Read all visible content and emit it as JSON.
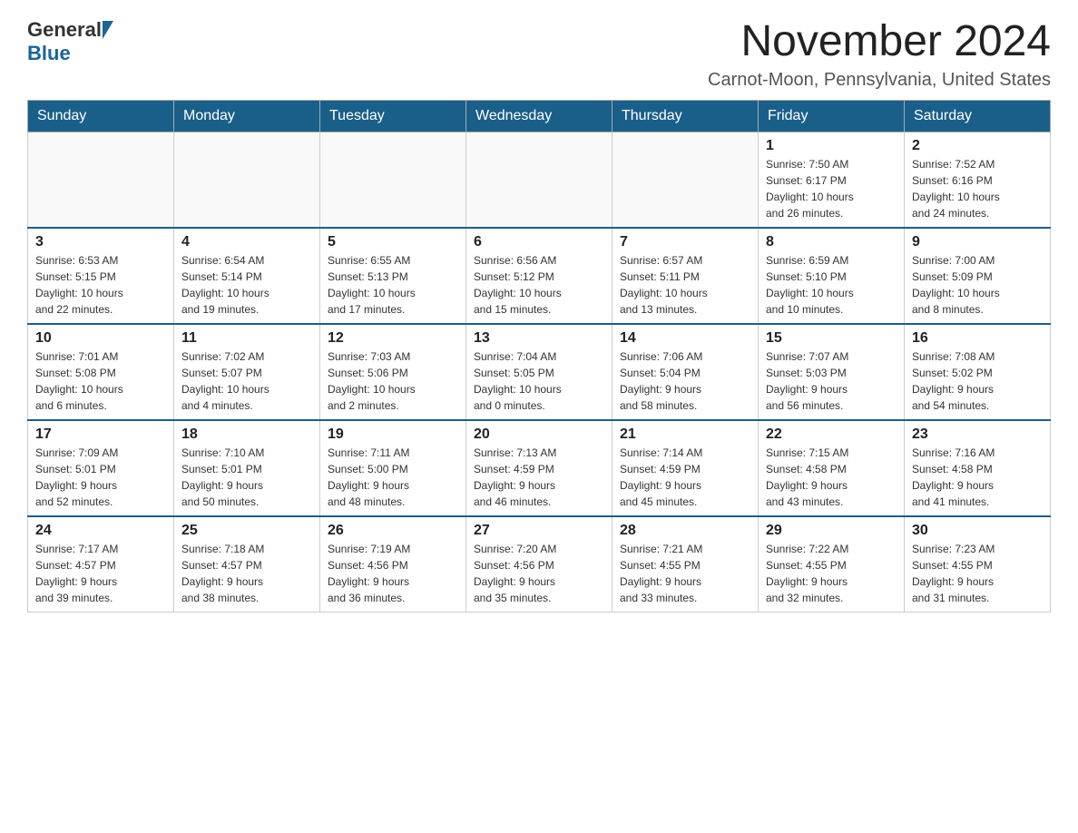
{
  "logo": {
    "general": "General",
    "blue": "Blue"
  },
  "title": "November 2024",
  "subtitle": "Carnot-Moon, Pennsylvania, United States",
  "days_of_week": [
    "Sunday",
    "Monday",
    "Tuesday",
    "Wednesday",
    "Thursday",
    "Friday",
    "Saturday"
  ],
  "weeks": [
    [
      {
        "day": "",
        "info": ""
      },
      {
        "day": "",
        "info": ""
      },
      {
        "day": "",
        "info": ""
      },
      {
        "day": "",
        "info": ""
      },
      {
        "day": "",
        "info": ""
      },
      {
        "day": "1",
        "info": "Sunrise: 7:50 AM\nSunset: 6:17 PM\nDaylight: 10 hours\nand 26 minutes."
      },
      {
        "day": "2",
        "info": "Sunrise: 7:52 AM\nSunset: 6:16 PM\nDaylight: 10 hours\nand 24 minutes."
      }
    ],
    [
      {
        "day": "3",
        "info": "Sunrise: 6:53 AM\nSunset: 5:15 PM\nDaylight: 10 hours\nand 22 minutes."
      },
      {
        "day": "4",
        "info": "Sunrise: 6:54 AM\nSunset: 5:14 PM\nDaylight: 10 hours\nand 19 minutes."
      },
      {
        "day": "5",
        "info": "Sunrise: 6:55 AM\nSunset: 5:13 PM\nDaylight: 10 hours\nand 17 minutes."
      },
      {
        "day": "6",
        "info": "Sunrise: 6:56 AM\nSunset: 5:12 PM\nDaylight: 10 hours\nand 15 minutes."
      },
      {
        "day": "7",
        "info": "Sunrise: 6:57 AM\nSunset: 5:11 PM\nDaylight: 10 hours\nand 13 minutes."
      },
      {
        "day": "8",
        "info": "Sunrise: 6:59 AM\nSunset: 5:10 PM\nDaylight: 10 hours\nand 10 minutes."
      },
      {
        "day": "9",
        "info": "Sunrise: 7:00 AM\nSunset: 5:09 PM\nDaylight: 10 hours\nand 8 minutes."
      }
    ],
    [
      {
        "day": "10",
        "info": "Sunrise: 7:01 AM\nSunset: 5:08 PM\nDaylight: 10 hours\nand 6 minutes."
      },
      {
        "day": "11",
        "info": "Sunrise: 7:02 AM\nSunset: 5:07 PM\nDaylight: 10 hours\nand 4 minutes."
      },
      {
        "day": "12",
        "info": "Sunrise: 7:03 AM\nSunset: 5:06 PM\nDaylight: 10 hours\nand 2 minutes."
      },
      {
        "day": "13",
        "info": "Sunrise: 7:04 AM\nSunset: 5:05 PM\nDaylight: 10 hours\nand 0 minutes."
      },
      {
        "day": "14",
        "info": "Sunrise: 7:06 AM\nSunset: 5:04 PM\nDaylight: 9 hours\nand 58 minutes."
      },
      {
        "day": "15",
        "info": "Sunrise: 7:07 AM\nSunset: 5:03 PM\nDaylight: 9 hours\nand 56 minutes."
      },
      {
        "day": "16",
        "info": "Sunrise: 7:08 AM\nSunset: 5:02 PM\nDaylight: 9 hours\nand 54 minutes."
      }
    ],
    [
      {
        "day": "17",
        "info": "Sunrise: 7:09 AM\nSunset: 5:01 PM\nDaylight: 9 hours\nand 52 minutes."
      },
      {
        "day": "18",
        "info": "Sunrise: 7:10 AM\nSunset: 5:01 PM\nDaylight: 9 hours\nand 50 minutes."
      },
      {
        "day": "19",
        "info": "Sunrise: 7:11 AM\nSunset: 5:00 PM\nDaylight: 9 hours\nand 48 minutes."
      },
      {
        "day": "20",
        "info": "Sunrise: 7:13 AM\nSunset: 4:59 PM\nDaylight: 9 hours\nand 46 minutes."
      },
      {
        "day": "21",
        "info": "Sunrise: 7:14 AM\nSunset: 4:59 PM\nDaylight: 9 hours\nand 45 minutes."
      },
      {
        "day": "22",
        "info": "Sunrise: 7:15 AM\nSunset: 4:58 PM\nDaylight: 9 hours\nand 43 minutes."
      },
      {
        "day": "23",
        "info": "Sunrise: 7:16 AM\nSunset: 4:58 PM\nDaylight: 9 hours\nand 41 minutes."
      }
    ],
    [
      {
        "day": "24",
        "info": "Sunrise: 7:17 AM\nSunset: 4:57 PM\nDaylight: 9 hours\nand 39 minutes."
      },
      {
        "day": "25",
        "info": "Sunrise: 7:18 AM\nSunset: 4:57 PM\nDaylight: 9 hours\nand 38 minutes."
      },
      {
        "day": "26",
        "info": "Sunrise: 7:19 AM\nSunset: 4:56 PM\nDaylight: 9 hours\nand 36 minutes."
      },
      {
        "day": "27",
        "info": "Sunrise: 7:20 AM\nSunset: 4:56 PM\nDaylight: 9 hours\nand 35 minutes."
      },
      {
        "day": "28",
        "info": "Sunrise: 7:21 AM\nSunset: 4:55 PM\nDaylight: 9 hours\nand 33 minutes."
      },
      {
        "day": "29",
        "info": "Sunrise: 7:22 AM\nSunset: 4:55 PM\nDaylight: 9 hours\nand 32 minutes."
      },
      {
        "day": "30",
        "info": "Sunrise: 7:23 AM\nSunset: 4:55 PM\nDaylight: 9 hours\nand 31 minutes."
      }
    ]
  ]
}
